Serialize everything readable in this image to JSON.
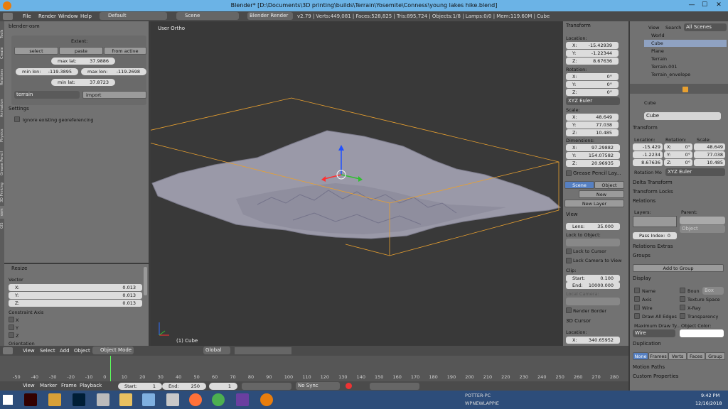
{
  "window": {
    "title": "Blender* [D:\\Documents\\3D printing\\builds\\Terrain\\Yosemite\\Conness\\young lakes hike.blend]",
    "min": "—",
    "max": "☐",
    "close": "✕"
  },
  "topbar": {
    "menus": [
      "File",
      "Render",
      "Window",
      "Help"
    ],
    "layout": "Default",
    "scene": "Scene",
    "engine": "Blender Render",
    "stats": "v2.79 | Verts:449,081 | Faces:528,825 | Tris:895,724 | Objects:1/8 | Lamps:0/0 | Mem:119.60M | Cube"
  },
  "left_tabs": [
    "Tools",
    "Create",
    "Relations",
    "Animation",
    "Physics",
    "Grease Pencil",
    "3D Printing",
    "osm",
    "GIS"
  ],
  "osm_panel": {
    "title": "blender-osm",
    "extent_label": "Extent:",
    "select": "select",
    "paste": "paste",
    "from_active": "from active",
    "max_lat_label": "max lat:",
    "max_lat": "37.9886",
    "min_lon_label": "min lon:",
    "min_lon": "-119.3895",
    "max_lon_label": "max lon:",
    "max_lon": "-119.2698",
    "min_lat_label": "min lat:",
    "min_lat": "37.8723",
    "source": "terrain",
    "import": "import"
  },
  "settings_panel": {
    "title": "Settings",
    "ignore": "Ignore existing georeferencing"
  },
  "resize_panel": {
    "title": "Resize",
    "vector_label": "Vector",
    "x_label": "X:",
    "x": "0.013",
    "y_label": "Y:",
    "y": "0.013",
    "z_label": "Z:",
    "z": "0.013",
    "constraint_label": "Constraint Axis",
    "cx": "X",
    "cy": "Y",
    "cz": "Z",
    "orientation_label": "Orientation"
  },
  "viewport": {
    "view_label": "User Ortho",
    "object_label": "(1) Cube"
  },
  "npanel": {
    "transform": "Transform",
    "location": "Location:",
    "loc_x": "-15.42939",
    "loc_y": "-1.22344",
    "loc_z": "8.67636",
    "rotation": "Rotation:",
    "rot_x": "0°",
    "rot_y": "0°",
    "rot_z": "0°",
    "rot_mode": "XYZ Euler",
    "scale": "Scale:",
    "sc_x": "48.649",
    "sc_y": "77.038",
    "sc_z": "10.485",
    "dimensions": "Dimensions:",
    "dim_x": "97.29882",
    "dim_y": "154.07582",
    "dim_z": "20.96935",
    "grease": "Grease Pencil Lay...",
    "scene_tab": "Scene",
    "object_tab": "Object",
    "new": "New",
    "new_layer": "New Layer",
    "view": "View",
    "lens_label": "Lens:",
    "lens": "35.000",
    "lock_obj": "Lock to Object:",
    "lock_cursor": "Lock to Cursor",
    "lock_camera": "Lock Camera to View",
    "clip": "Clip:",
    "start_label": "Start:",
    "start": "0.100",
    "end_label": "End:",
    "end": "10000.000",
    "local_camera": "Local Camera:",
    "render_border": "Render Border",
    "cursor": "3D Cursor",
    "location2": "Location:",
    "cur_x": "340.65952",
    "x_label": "X:",
    "y_label": "Y:",
    "z_label": "Z:"
  },
  "outliner": {
    "view": "View",
    "search": "Search",
    "scenes": "All Scenes",
    "items": [
      "World",
      "Cube",
      "Plane",
      "Terrain",
      "Terrain.001",
      "Terrain_envelope"
    ]
  },
  "props": {
    "object_name": "Cube",
    "name_field": "Cube",
    "transform": "Transform",
    "location": "Location:",
    "rotation": "Rotation:",
    "scale": "Scale:",
    "loc": [
      "-15.429",
      "-1.2234",
      "8.67636"
    ],
    "rot": [
      "0°",
      "0°",
      "0°"
    ],
    "sc": [
      "48.649",
      "77.038",
      "10.485"
    ],
    "x_label": "X:",
    "y_label": "Y:",
    "z_label": "Z:",
    "rot_mode_label": "Rotation Mo",
    "rot_mode": "XYZ Euler",
    "delta": "Delta Transform",
    "locks": "Transform Locks",
    "relations": "Relations",
    "layers": "Layers:",
    "parent": "Parent:",
    "pass_index_label": "Pass Index:",
    "pass_index": "0",
    "parent_type": "Object",
    "relations_extras": "Relations Extras",
    "groups": "Groups",
    "add_group": "Add to Group",
    "display": "Display",
    "name": "Name",
    "bounds": "Boun",
    "box": "Box",
    "axis": "Axis",
    "texture_space": "Texture Space",
    "wire": "Wire",
    "xray": "X-Ray",
    "draw_all_edges": "Draw All Edges",
    "transparency": "Transparency",
    "max_draw": "Maximum Draw Ty...",
    "obj_color": "Object Color:",
    "draw_type": "Wire",
    "duplication": "Duplication",
    "dup_none": "None",
    "dup_frames": "Frames",
    "dup_verts": "Verts",
    "dup_faces": "Faces",
    "dup_group": "Group",
    "motion_paths": "Motion Paths",
    "custom_props": "Custom Properties"
  },
  "vpheader": {
    "view": "View",
    "select": "Select",
    "add": "Add",
    "object": "Object",
    "mode": "Object Mode",
    "orientation": "Global"
  },
  "timeline": {
    "ticks": [
      "-50",
      "-40",
      "-30",
      "-20",
      "-10",
      "0",
      "10",
      "20",
      "30",
      "40",
      "50",
      "60",
      "70",
      "80",
      "90",
      "100",
      "110",
      "120",
      "130",
      "140",
      "150",
      "160",
      "170",
      "180",
      "190",
      "200",
      "210",
      "220",
      "230",
      "240",
      "250",
      "260",
      "270",
      "280"
    ],
    "view": "View",
    "marker": "Marker",
    "frame": "Frame",
    "playback": "Playback",
    "start_label": "Start:",
    "start": "1",
    "end_label": "End:",
    "end": "250",
    "current": "1",
    "sync": "No Sync"
  },
  "taskbar": {
    "pc": "POTTER-PC",
    "net": "WPNEWLAPPIE",
    "time": "9:42 PM",
    "date": "12/16/2018"
  },
  "colors": {
    "accent": "#5680c2",
    "blender_orange": "#e87d0d",
    "selection": "#f0a030"
  }
}
